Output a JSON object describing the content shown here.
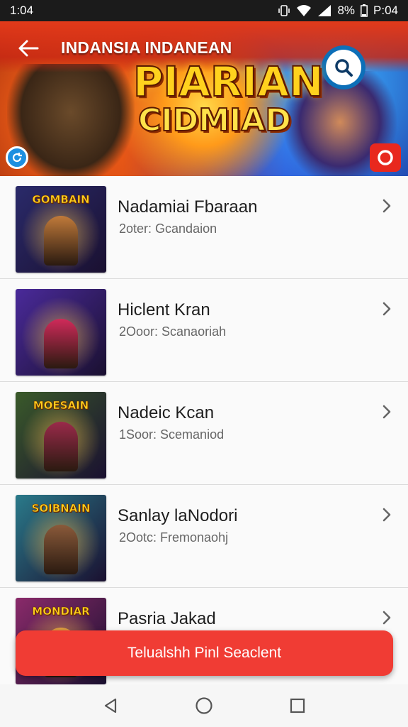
{
  "status_bar": {
    "time": "1:04",
    "battery_text": "8%",
    "right_time": "P:04",
    "icons": [
      "vibrate-icon",
      "wifi-icon",
      "signal-icon",
      "battery-icon"
    ]
  },
  "header": {
    "title": "INDANSIA INDANEAN",
    "logo_line1": "PIARIAN",
    "logo_line2": "CIDMIAD",
    "accent_color": "#e23a1a"
  },
  "list": {
    "items": [
      {
        "title": "Nadamiai Fbaraan",
        "subtitle": "2oter: Gcandaion",
        "thumb_caption": "GOMBAIN",
        "thumb_bg": "#2a2a6a",
        "thumb_figure": "#c07a3a"
      },
      {
        "title": "Hiclent Kran",
        "subtitle": "2Ooor: Scanaoriah",
        "thumb_caption": "",
        "thumb_bg": "#4a2a9a",
        "thumb_figure": "#d02a5a"
      },
      {
        "title": "Nadeic Kcan",
        "subtitle": "1Soor: Scemaniod",
        "thumb_caption": "MOESAIN",
        "thumb_bg": "#3a5a2a",
        "thumb_figure": "#9a2a4a"
      },
      {
        "title": "Sanlay laNodori",
        "subtitle": "2Ootc: Fremonaohj",
        "thumb_caption": "SOIBNAIN",
        "thumb_bg": "#2a7a8a",
        "thumb_figure": "#8a5a3a"
      },
      {
        "title": "Pasria Jakad",
        "subtitle": "",
        "thumb_caption": "MONDIAR",
        "thumb_bg": "#8a2a6a",
        "thumb_figure": "#e0a040"
      }
    ]
  },
  "cta": {
    "label": "Telualshh Pinl Seaclent"
  }
}
